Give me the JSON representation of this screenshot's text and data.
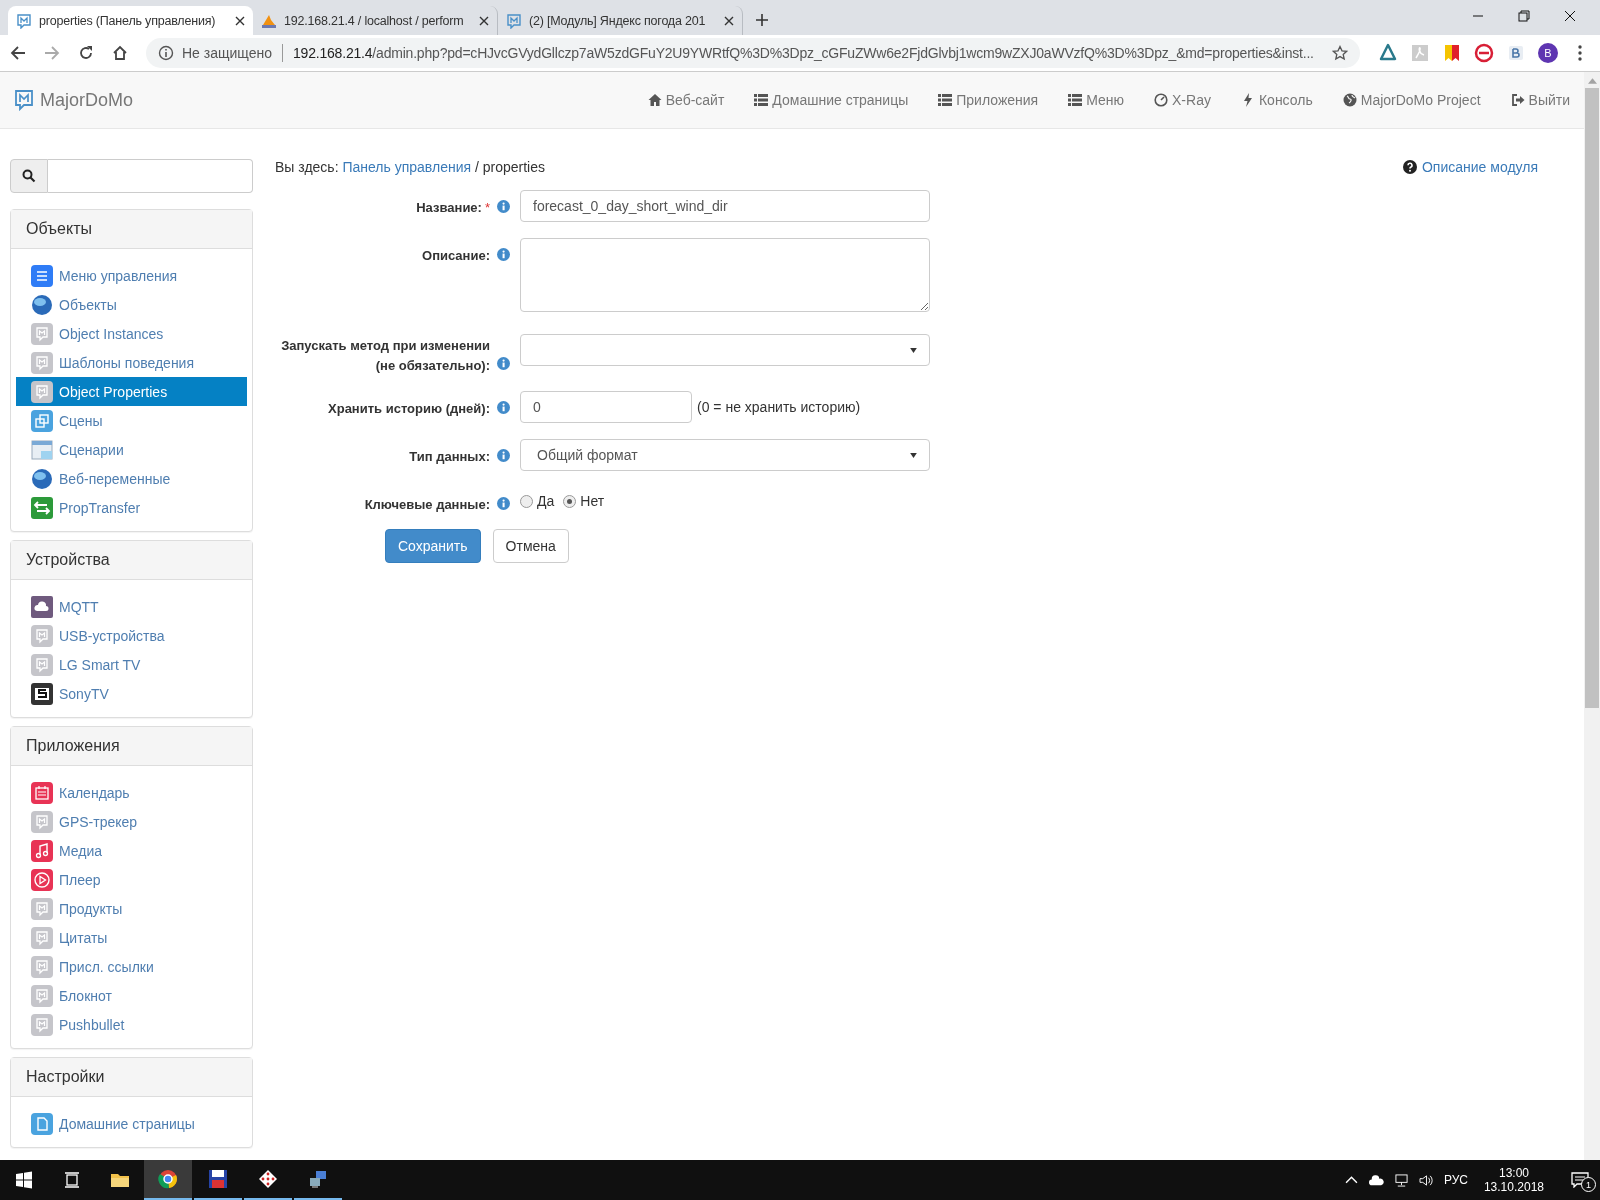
{
  "browser": {
    "tabs": [
      {
        "title": "properties (Панель управления)",
        "selected": true
      },
      {
        "title": "192.168.21.4 / localhost / perform",
        "selected": false
      },
      {
        "title": "(2) [Модуль] Яндекс погода 201",
        "selected": false
      }
    ],
    "security": "Не защищено",
    "url_host": "192.168.21.4",
    "url_path": "/admin.php?pd=cHJvcGVydGllczp7aW5zdGFuY2U9YWRtfQ%3D%3Dpz_cGFuZWw6e2FjdGlvbj1wcm9wZXJ0aWVzfQ%3D%3Dpz_&md=properties&inst...",
    "profile": "B"
  },
  "navbar": {
    "brand": "MajorDoMo",
    "links": [
      {
        "label": "Веб-сайт"
      },
      {
        "label": "Домашние страницы"
      },
      {
        "label": "Приложения"
      },
      {
        "label": "Меню"
      },
      {
        "label": "X-Ray"
      },
      {
        "label": "Консоль"
      },
      {
        "label": "MajorDoMo Project"
      },
      {
        "label": "Выйти"
      }
    ]
  },
  "sidebar": {
    "sections": [
      {
        "title": "Объекты",
        "items": [
          {
            "label": "Меню управления",
            "kind": "menu",
            "selected": false
          },
          {
            "label": "Объекты",
            "kind": "globe",
            "selected": false
          },
          {
            "label": "Object Instances",
            "kind": "m",
            "selected": false
          },
          {
            "label": "Шаблоны поведения",
            "kind": "m",
            "selected": false
          },
          {
            "label": "Object Properties",
            "kind": "m",
            "selected": true
          },
          {
            "label": "Сцены",
            "kind": "scenes",
            "selected": false
          },
          {
            "label": "Сценарии",
            "kind": "scripts",
            "selected": false
          },
          {
            "label": "Веб-переменные",
            "kind": "globe",
            "selected": false
          },
          {
            "label": "PropTransfer",
            "kind": "transfer",
            "selected": false
          }
        ]
      },
      {
        "title": "Устройства",
        "items": [
          {
            "label": "MQTT",
            "kind": "mqtt",
            "selected": false
          },
          {
            "label": "USB-устройства",
            "kind": "m",
            "selected": false
          },
          {
            "label": "LG Smart TV",
            "kind": "m",
            "selected": false
          },
          {
            "label": "SonyTV",
            "kind": "sony",
            "selected": false
          }
        ]
      },
      {
        "title": "Приложения",
        "items": [
          {
            "label": "Календарь",
            "kind": "calendar",
            "selected": false
          },
          {
            "label": "GPS-трекер",
            "kind": "m",
            "selected": false
          },
          {
            "label": "Медиа",
            "kind": "media",
            "selected": false
          },
          {
            "label": "Плеер",
            "kind": "player",
            "selected": false
          },
          {
            "label": "Продукты",
            "kind": "m",
            "selected": false
          },
          {
            "label": "Цитаты",
            "kind": "m",
            "selected": false
          },
          {
            "label": "Присл. ссылки",
            "kind": "m",
            "selected": false
          },
          {
            "label": "Блокнот",
            "kind": "m",
            "selected": false
          },
          {
            "label": "Pushbullet",
            "kind": "m",
            "selected": false
          }
        ]
      },
      {
        "title": "Настройки",
        "items": [
          {
            "label": "Домашние страницы",
            "kind": "page",
            "selected": false
          }
        ]
      }
    ]
  },
  "breadcrumb": {
    "prefix": "Вы здесь:",
    "link": "Панель управления",
    "rest": "/ properties"
  },
  "help_link": "Описание модуля",
  "form": {
    "fields": [
      {
        "kind": "text",
        "label": "Название:",
        "required_mark": "*",
        "value": "forecast_0_day_short_wind_dir"
      },
      {
        "kind": "textarea",
        "label": "Описание:"
      },
      {
        "kind": "select",
        "label": "Запускать метод при изменении (не обязательно):"
      },
      {
        "kind": "number",
        "label": "Хранить историю (дней):",
        "value": "0",
        "hint": "(0 = не хранить историю)"
      },
      {
        "kind": "select",
        "label": "Тип данных:",
        "value": "Общий формат"
      },
      {
        "kind": "radio",
        "label": "Ключевые данные:",
        "options": [
          {
            "label": "Да",
            "selected": false
          },
          {
            "label": "Нет",
            "selected": true
          }
        ]
      }
    ],
    "buttons": [
      {
        "label": "Сохранить",
        "kind": "primary"
      },
      {
        "label": "Отмена",
        "kind": "default"
      }
    ]
  },
  "taskbar": {
    "language": "РУС",
    "time": "13:00",
    "date": "13.10.2018",
    "notifications": "1"
  }
}
